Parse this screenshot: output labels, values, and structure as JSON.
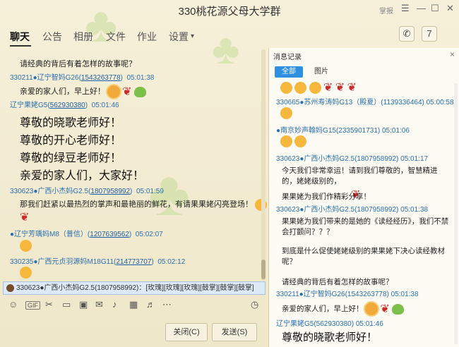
{
  "window": {
    "title": "330桃花源父母大学群",
    "login_text": "掌报"
  },
  "tabs": [
    {
      "label": "聊天"
    },
    {
      "label": "公告"
    },
    {
      "label": "相册"
    },
    {
      "label": "文件"
    },
    {
      "label": "作业"
    },
    {
      "label": "设置"
    }
  ],
  "settings_caret": "▾",
  "chat": {
    "messages": [
      {
        "text": "请经典的背后有着怎样的故事呢？"
      },
      {
        "meta_pre": "330211●辽宁智妈G26(",
        "uid": "1543263778",
        "meta_post": ")",
        "time": "05:01:38"
      },
      {
        "text": "亲爱的家人们，早上好！"
      },
      {
        "meta_pre": "辽宁果姥G5(",
        "uid": "562930380",
        "meta_post": ")",
        "time": "05:01:46"
      },
      {
        "text": "尊敬的晓歌老师好！"
      },
      {
        "text": "尊敬的开心老师好！"
      },
      {
        "text": "尊敬的绿豆老师好！"
      },
      {
        "text": "亲爱的家人们，大家好！"
      },
      {
        "meta_pre": "330623●广西小杰妈G2.5(",
        "uid": "1807958992",
        "meta_post": ")",
        "time": "05:01:59"
      },
      {
        "text": "那我们赶紧以最热烈的掌声和最艳丽的鲜花，有请果果姥闪亮登场！"
      },
      {
        "meta_pre": "●辽宁芳瑀妈M8（普信）(",
        "uid": "1207639562",
        "meta_post": ")",
        "time": "05:02:07"
      },
      {
        "meta_pre": "330235●广西元贞羽源妈M18G11(",
        "uid": "214773707",
        "meta_post": ")",
        "time": "05:02:12"
      }
    ]
  },
  "notice": {
    "text": "330623●广西小杰妈G2.5(1807958992)：[玫瑰][玫瑰][玫瑰][鼓掌][鼓掌][鼓掌]"
  },
  "buttons": {
    "close": "关闭(C)",
    "send": "发送(S)"
  },
  "history": {
    "title": "消息记录",
    "close_symbol": "×",
    "tab_all": "全部",
    "tab_pictures": "图片",
    "entries": [
      {
        "meta": "330665●苏州寿涛妈G13（殿夏）(1139336464) 05:00:58"
      },
      {
        "meta": "●南京妙声翰妈G15(2335901731) 05:01:06"
      },
      {
        "meta": "330623●广西小杰妈G2.5(1807958992) 05:01:17"
      },
      {
        "text": "今天我们非常幸运！请到我们尊敬的，智慧精进"
      },
      {
        "text": "的，姥姥级别的，"
      },
      {
        "text": "果果姥为我们作精彩分享！"
      },
      {
        "meta": "330623●广西小杰妈G2.5(1807958992) 05:01:38"
      },
      {
        "text": "果果姥为我们带来的是她的《读经经历》，我们不禁"
      },
      {
        "text": "会打颤问？？？"
      },
      {
        "text": "到底是什么促使姥姥级别的果果姥下决心读经教材"
      },
      {
        "text": "呢？"
      },
      {
        "text": "请经典的背后有着怎样的故事呢？"
      },
      {
        "meta": "330211●辽宁智妈G26(1543263778) 05:01:38"
      },
      {
        "text": "亲爱的家人们，早上好！"
      },
      {
        "meta": "辽宁果姥G5(562930380) 05:01:46"
      },
      {
        "text": "尊敬的晓歌老师好！"
      }
    ]
  }
}
